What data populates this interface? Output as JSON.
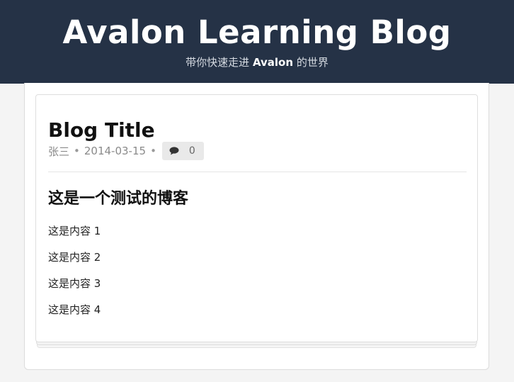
{
  "header": {
    "title": "Avalon Learning Blog",
    "subtitle_prefix": "带你快速走进 ",
    "subtitle_brand": "Avalon",
    "subtitle_suffix": " 的世界",
    "background_color": "#253246"
  },
  "post": {
    "title": "Blog Title",
    "author": "张三",
    "separator": "•",
    "date": "2014-03-15",
    "comment_icon": "comment-icon",
    "comment_count": "0",
    "heading": "这是一个测试的博客",
    "lines": [
      "这是内容 1",
      "这是内容 2",
      "这是内容 3",
      "这是内容 4"
    ]
  }
}
